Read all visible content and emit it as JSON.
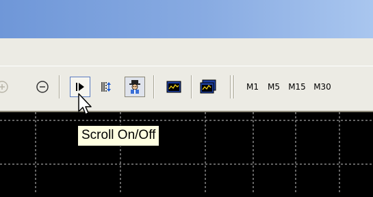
{
  "window": {
    "titlebar_color": "#7aa0de"
  },
  "toolbar": {
    "buttons": [
      {
        "name": "zoom-in-button",
        "icon": "zoom-in-icon"
      },
      {
        "name": "zoom-out-button",
        "icon": "zoom-out-icon"
      },
      {
        "name": "scroll-toggle-button",
        "icon": "scroll-arrow-icon"
      },
      {
        "name": "chart-shift-button",
        "icon": "chart-shift-icon"
      },
      {
        "name": "experts-button",
        "icon": "expert-advisor-icon"
      },
      {
        "name": "indicators-button",
        "icon": "indicator-window-icon"
      },
      {
        "name": "templates-button",
        "icon": "template-window-icon"
      }
    ],
    "timeframes": [
      "M1",
      "M5",
      "M15",
      "M30"
    ]
  },
  "tooltip": {
    "text": "Scroll On/Off"
  },
  "chart": {
    "background": "#000000",
    "grid_color": "#c8c8c8"
  }
}
